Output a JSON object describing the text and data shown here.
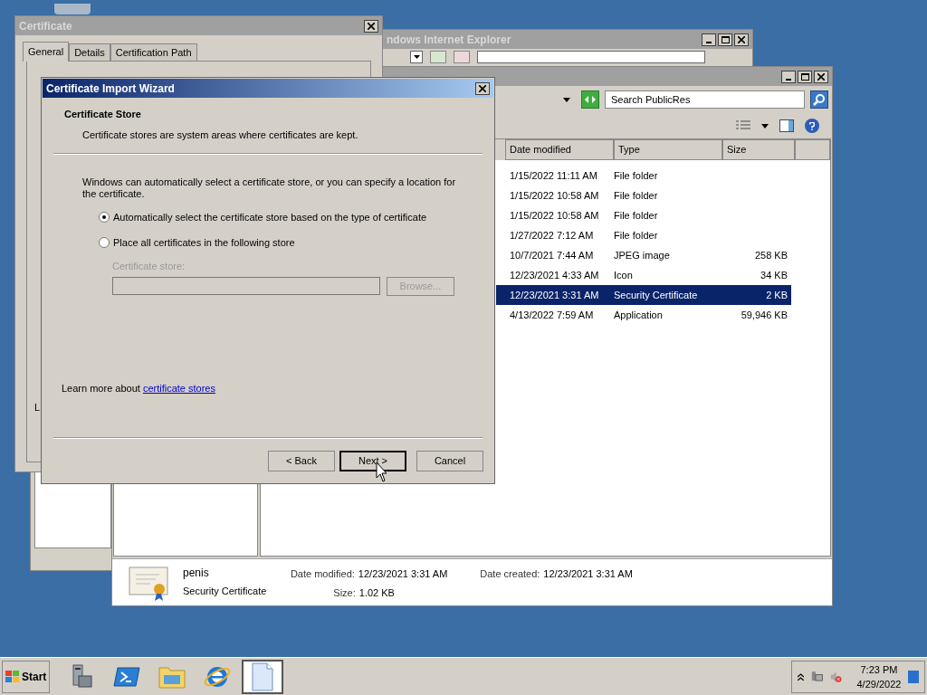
{
  "ie_window": {
    "title": "ndows Internet Explorer",
    "active": false
  },
  "explorer": {
    "active": false,
    "search_placeholder": "Search PublicRes",
    "columns": [
      "Date modified",
      "Type",
      "Size"
    ],
    "rows": [
      {
        "date": "1/15/2022 11:11 AM",
        "type": "File folder",
        "selected": false
      },
      {
        "date": "1/15/2022 10:58 AM",
        "type": "File folder",
        "selected": false
      },
      {
        "date": "1/15/2022 10:58 AM",
        "type": "File folder",
        "selected": false
      },
      {
        "date": "1/27/2022 7:12 AM",
        "type": "File folder",
        "selected": false
      },
      {
        "date": "10/7/2021 7:44 AM",
        "type": "JPEG image",
        "size": "258 KB",
        "selected": false
      },
      {
        "date": "12/23/2021 4:33 AM",
        "type": "Icon",
        "size": "34 KB",
        "selected": false
      },
      {
        "date": "12/23/2021 3:31 AM",
        "type": "Security Certificate",
        "size": "2 KB",
        "selected": true
      },
      {
        "date": "4/13/2022 7:59 AM",
        "type": "Application",
        "size": "59,946 KB",
        "selected": false
      }
    ],
    "details": {
      "name": "penis",
      "type": "Security Certificate",
      "modified_label": "Date modified:",
      "modified": "12/23/2021 3:31 AM",
      "created_label": "Date created:",
      "created": "12/23/2021 3:31 AM",
      "size_label": "Size:",
      "size": "1.02 KB"
    }
  },
  "certificate_window": {
    "title": "Certificate",
    "active": false,
    "tabs": [
      {
        "label": "General",
        "selected": true
      },
      {
        "label": "Details",
        "selected": false
      },
      {
        "label": "Certification Path",
        "selected": false
      }
    ],
    "cut_text": "L"
  },
  "wizard": {
    "title": "Certificate Import Wizard",
    "active": true,
    "heading": "Certificate Store",
    "subheading": "Certificate stores are system areas where certificates are kept.",
    "intro": "Windows can automatically select a certificate store, or you can specify a location for the certificate.",
    "options": [
      {
        "label": "Automatically select the certificate store based on the type of certificate",
        "selected": true
      },
      {
        "label": "Place all certificates in the following store",
        "selected": false
      }
    ],
    "store_label": "Certificate store:",
    "store_disabled": true,
    "browse": "Browse...",
    "learn_more": "Learn more about",
    "link": "certificate stores",
    "buttons": [
      {
        "label": "< Back",
        "default": false
      },
      {
        "label": "Next >",
        "default": true
      },
      {
        "label": "Cancel",
        "default": false
      }
    ]
  },
  "taskbar": {
    "start": "Start",
    "apps": [
      {
        "kind": "server",
        "active": false
      },
      {
        "kind": "shell",
        "active": false
      },
      {
        "kind": "folder",
        "active": false
      },
      {
        "kind": "browser",
        "active": false
      },
      {
        "kind": "document",
        "active": true
      }
    ],
    "time": "7:23 PM",
    "date": "4/29/2022"
  }
}
